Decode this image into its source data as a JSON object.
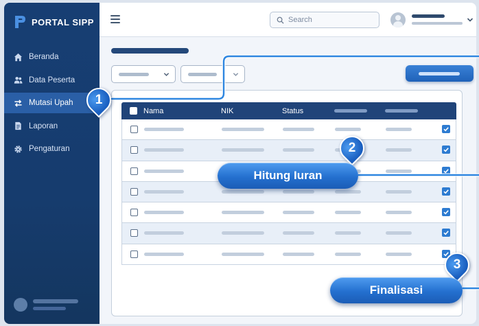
{
  "brand": {
    "name": "PORTAL SIPP"
  },
  "sidebar": {
    "items": [
      {
        "label": "Beranda",
        "icon": "home-icon",
        "active": false
      },
      {
        "label": "Data Peserta",
        "icon": "users-icon",
        "active": false
      },
      {
        "label": "Mutasi Upah",
        "icon": "swap-arrows-icon",
        "active": true
      },
      {
        "label": "Laporan",
        "icon": "document-icon",
        "active": false
      },
      {
        "label": "Pengaturan",
        "icon": "gear-icon",
        "active": false
      }
    ]
  },
  "topbar": {
    "search_placeholder": "Search"
  },
  "table": {
    "columns": [
      "Nama",
      "NIK",
      "Status"
    ],
    "row_count": 7,
    "checked_last_column": true
  },
  "callouts": [
    {
      "number": "1"
    },
    {
      "number": "2",
      "label": "Hitung Iuran"
    },
    {
      "number": "3",
      "label": "Finalisasi"
    }
  ],
  "colors": {
    "sidebar": "#173e73",
    "header": "#204479",
    "accent": "#2d7bd1",
    "callout_line": "#2e86e0"
  }
}
